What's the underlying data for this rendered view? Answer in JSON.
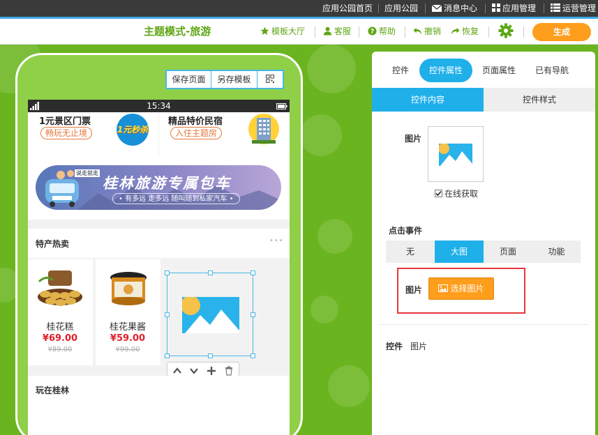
{
  "topnav": {
    "items": [
      "应用公园首页",
      "应用公园",
      "消息中心",
      "应用管理",
      "运营管理"
    ]
  },
  "toolbar": {
    "title": "主题模式-旅游",
    "template_hall": "模板大厅",
    "service": "客服",
    "help": "帮助",
    "undo": "撤销",
    "redo": "恢复",
    "generate": "生成"
  },
  "phone": {
    "actions": [
      "保存页面",
      "另存模板"
    ],
    "time": "15:34",
    "tickets": [
      {
        "title": "1元景区门票",
        "tag": "畅玩无止境",
        "badge": "1元秒杀"
      },
      {
        "title": "精品特价民宿",
        "tag": "入住主题房"
      }
    ],
    "banner": {
      "title": "桂林旅游专属包车",
      "subtitle": "• 有多远  走多远  随叫随到私家汽车 •",
      "badge": "说走就走"
    },
    "section1": {
      "title": "特产热卖",
      "more": "•••"
    },
    "products": [
      {
        "name": "桂花糕",
        "price": "¥69.00",
        "old": "¥89.00"
      },
      {
        "name": "桂花果酱",
        "price": "¥59.00",
        "old": "¥99.00"
      }
    ],
    "section2": {
      "title": "玩在桂林"
    }
  },
  "panel": {
    "tabs": [
      "控件",
      "控件属性",
      "页面属性",
      "已有导航"
    ],
    "subtabs": [
      "控件内容",
      "控件样式"
    ],
    "image_label": "图片",
    "online_fetch": "在线获取",
    "click_event_label": "点击事件",
    "events": [
      "无",
      "大图",
      "页面",
      "功能"
    ],
    "image_label2": "图片",
    "choose_image": "选择图片",
    "widget_label": "控件",
    "widget_value": "图片"
  },
  "colors": {
    "accent_blue": "#1fb0ea",
    "brand_green": "#5fa615",
    "orange": "#ff9d1c",
    "price_red": "#e0202a"
  }
}
